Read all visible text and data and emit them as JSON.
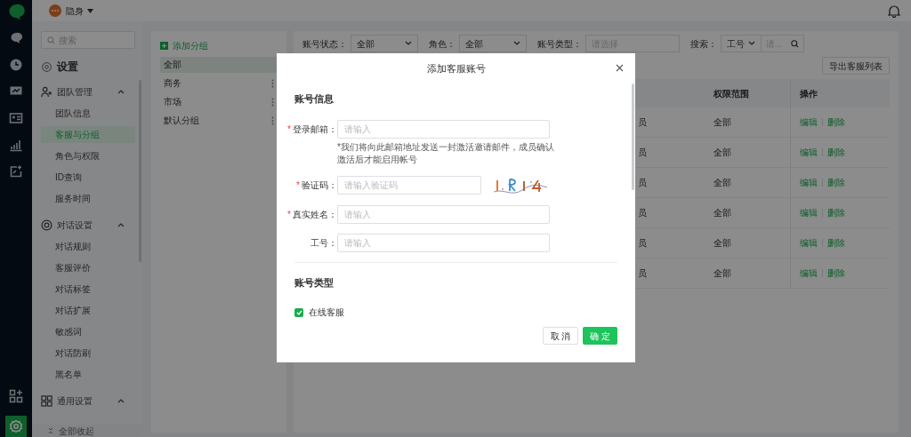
{
  "status": {
    "label": "隐身"
  },
  "rail": [
    {
      "kind": "logo",
      "selected": false
    },
    {
      "kind": "chat",
      "selected": false
    },
    {
      "kind": "history",
      "selected": false
    },
    {
      "kind": "monitor",
      "selected": false
    },
    {
      "kind": "contacts",
      "selected": false
    },
    {
      "kind": "stats",
      "selected": false
    },
    {
      "kind": "export",
      "selected": false
    }
  ],
  "rail_bottom": [
    {
      "kind": "apps",
      "selected": false
    },
    {
      "kind": "settings",
      "selected": true
    }
  ],
  "settings_nav": {
    "search_placeholder": "搜索",
    "title": "设置",
    "sections": [
      {
        "kind": "team",
        "label": "团队管理",
        "expanded": true,
        "children": [
          {
            "label": "团队信息",
            "selected": false
          },
          {
            "label": "客服与分组",
            "selected": true
          },
          {
            "label": "角色与权限",
            "selected": false
          },
          {
            "label": "ID查询",
            "selected": false
          },
          {
            "label": "服务时间",
            "selected": false
          }
        ]
      },
      {
        "kind": "chat",
        "label": "对话设置",
        "expanded": true,
        "children": [
          {
            "label": "对话规则",
            "selected": false
          },
          {
            "label": "客服评价",
            "selected": false
          },
          {
            "label": "对话标签",
            "selected": false
          },
          {
            "label": "对话扩展",
            "selected": false
          },
          {
            "label": "敏感词",
            "selected": false
          },
          {
            "label": "对话防刷",
            "selected": false
          },
          {
            "label": "黑名单",
            "selected": false
          }
        ]
      },
      {
        "kind": "general",
        "label": "通用设置",
        "expanded": true
      }
    ],
    "collapse_all": "全部收起"
  },
  "groups": {
    "add_label": "添加分组",
    "items": [
      {
        "label": "全部",
        "selected": true,
        "has_menu": false
      },
      {
        "label": "商务",
        "selected": false,
        "has_menu": true
      },
      {
        "label": "市场",
        "selected": false,
        "has_menu": true
      },
      {
        "label": "默认分组",
        "selected": false,
        "has_menu": true
      }
    ]
  },
  "filters": {
    "status_label": "账号状态：",
    "status_value": "全部",
    "role_label": "角色：",
    "role_value": "全部",
    "type_label": "账号类型：",
    "type_placeholder": "请选择",
    "search_label": "搜索：",
    "search_field": "工号",
    "search_placeholder": "请..."
  },
  "export_button": "导出客服列表",
  "table": {
    "columns": [
      {
        "label": "权限范围"
      },
      {
        "label": "操作"
      }
    ],
    "rows": [
      {
        "column_1": "员",
        "scope": "全部",
        "actions": [
          "编辑",
          "删除"
        ]
      },
      {
        "column_1": "员",
        "scope": "全部",
        "actions": [
          "编辑",
          "删除"
        ]
      },
      {
        "column_1": "员",
        "scope": "全部",
        "actions": [
          "编辑",
          "删除"
        ]
      },
      {
        "column_1": "员",
        "scope": "全部",
        "actions": [
          "编辑",
          "删除"
        ]
      },
      {
        "column_1": "员",
        "scope": "全部",
        "actions": [
          "编辑",
          "删除"
        ]
      },
      {
        "column_1": "员",
        "scope": "全部",
        "actions": [
          "编辑",
          "删除"
        ]
      }
    ]
  },
  "dialog": {
    "title": "添加客服账号",
    "section_1": "账号信息",
    "fields": [
      {
        "kind": "text",
        "label": "登录邮箱：",
        "required_mark": "*",
        "placeholder": "请输入",
        "hint": "*我们将向此邮箱地址发送一封激活邀请邮件，成员确认激活后才能启用帐号"
      },
      {
        "kind": "captcha",
        "label": "验证码：",
        "required_mark": "*",
        "placeholder": "请输入验证码"
      },
      {
        "kind": "text",
        "label": "真实姓名：",
        "required_mark": "*",
        "placeholder": "请输入"
      },
      {
        "kind": "text",
        "label": "工号：",
        "placeholder": "请输入"
      }
    ],
    "section_2": "账号类型",
    "account_types": [
      {
        "label": "在线客服",
        "checked": true
      }
    ],
    "cancel": "取 消",
    "confirm": "确 定"
  }
}
